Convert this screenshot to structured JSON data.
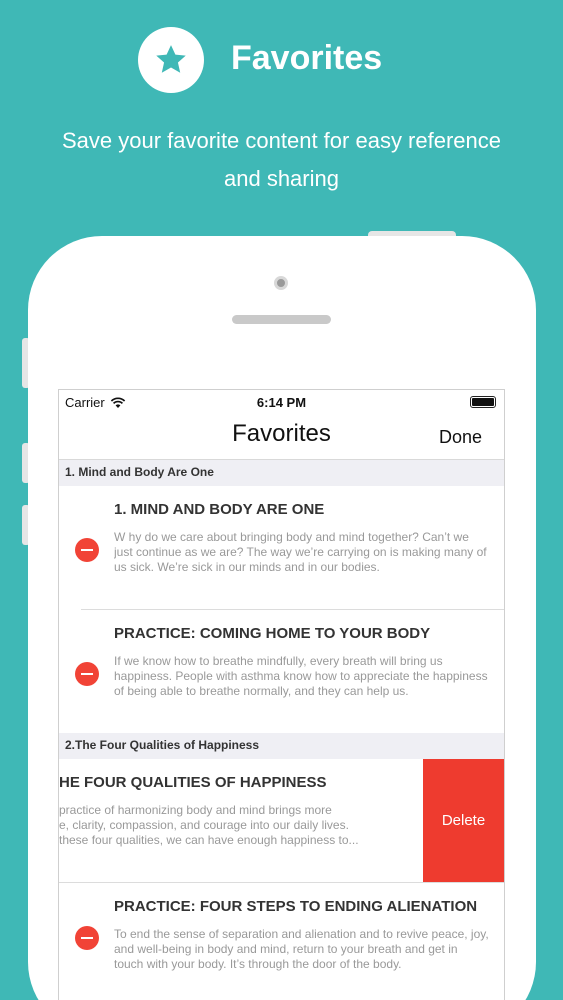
{
  "promo": {
    "title": "Favorites",
    "subtitle_line1": "Save your favorite content for easy reference",
    "subtitle_line2": "and sharing",
    "icon": "star-icon"
  },
  "status_bar": {
    "carrier": "Carrier",
    "time": "6:14 PM"
  },
  "nav": {
    "title": "Favorites",
    "done_label": "Done"
  },
  "sections": [
    {
      "header": "1. Mind and Body Are One",
      "rows": [
        {
          "title": "1. MIND AND BODY ARE ONE",
          "excerpt": "W hy do we care about bringing body and mind together? Can’t we just continue as we are? The way we’re carrying on is making many of us sick. We’re sick in our minds and in our bodies."
        },
        {
          "title": "PRACTICE: COMING HOME TO YOUR BODY",
          "excerpt": "If we know how to breathe mindfully, every breath will bring us happiness. People with asthma know how to appreciate the happiness of being able to breathe normally, and they can help us."
        }
      ]
    },
    {
      "header": "2.The Four Qualities of Happiness",
      "rows": [
        {
          "title": "HE FOUR QUALITIES OF HAPPINESS",
          "excerpt_line1": "practice of harmonizing body and mind brings more",
          "excerpt_line2": "e, clarity, compassion, and courage into our daily lives.",
          "excerpt_line3": "these four qualities, we can have enough happiness to...",
          "delete_label": "Delete"
        },
        {
          "title": "PRACTICE: FOUR STEPS TO ENDING ALIENATION",
          "excerpt": "To end the sense of separation and alienation and to revive peace, joy, and well-being in body and mind, return to your breath and get in touch with your body. It’s through the door of the body."
        }
      ]
    }
  ],
  "colors": {
    "background": "#3fb8b6",
    "delete": "#ee3b2f",
    "minus": "#f14336"
  }
}
